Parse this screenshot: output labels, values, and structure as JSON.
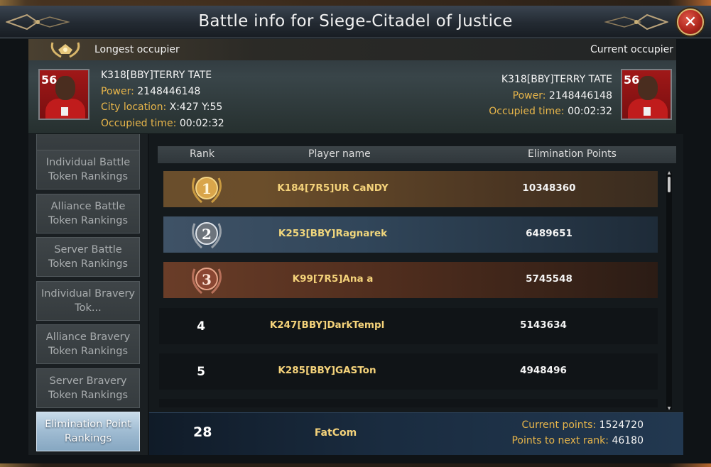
{
  "dialog": {
    "title": "Battle info for Siege-Citadel of Justice",
    "close_symbol": "✕"
  },
  "longest_occupier": {
    "label": "Longest occupier",
    "name": "K318[BBY]TERRY TATE",
    "power_label": "Power:",
    "power": "2148446148",
    "location_label": "City location:",
    "location": "X:427 Y:55",
    "occupied_label": "Occupied time:",
    "occupied_time": "00:02:32",
    "avatar_number": "56"
  },
  "current_occupier": {
    "label": "Current occupier",
    "name": "K318[BBY]TERRY TATE",
    "power_label": "Power:",
    "power": "2148446148",
    "occupied_label": "Occupied time:",
    "occupied_time": "00:02:32",
    "avatar_number": "56"
  },
  "tabs": [
    {
      "label": "Individual Battle Token Rankings",
      "active": false
    },
    {
      "label": "Alliance Battle Token Rankings",
      "active": false
    },
    {
      "label": "Server Battle Token Rankings",
      "active": false
    },
    {
      "label": "Individual Bravery Tok...",
      "active": false
    },
    {
      "label": "Alliance Bravery Token Rankings",
      "active": false
    },
    {
      "label": "Server Bravery Token Rankings",
      "active": false
    },
    {
      "label": "Elimination Point Rankings",
      "active": true
    }
  ],
  "table": {
    "headers": {
      "rank": "Rank",
      "player": "Player name",
      "points": "Elimination Points"
    },
    "rows": [
      {
        "rank": "1",
        "player": "K184[7R5]UR CaNDY",
        "points": "10348360",
        "medal": "gold"
      },
      {
        "rank": "2",
        "player": "K253[BBY]Ragnarek",
        "points": "6489651",
        "medal": "silver"
      },
      {
        "rank": "3",
        "player": "K99[7R5]Ana a",
        "points": "5745548",
        "medal": "bronze"
      },
      {
        "rank": "4",
        "player": "K247[BBY]DarkTempl",
        "points": "5143634",
        "medal": ""
      },
      {
        "rank": "5",
        "player": "K285[BBY]GASTon",
        "points": "4948496",
        "medal": ""
      }
    ]
  },
  "my_rank": {
    "rank": "28",
    "player": "FatCom",
    "current_points_label": "Current points:",
    "current_points": "1524720",
    "next_rank_label": "Points to next rank:",
    "next_rank_points": "46180"
  },
  "colors": {
    "gold_text": "#f4d27a",
    "label_orange": "#e7b54a",
    "active_tab": "#9fbbd2",
    "close_red": "#b0271d"
  },
  "icons": {
    "laurel": "laurel-wreath-icon",
    "close": "close-icon",
    "ornament": "ornament-icon"
  }
}
